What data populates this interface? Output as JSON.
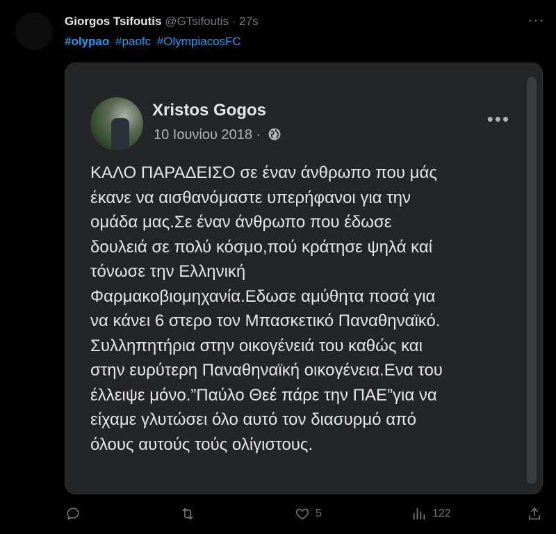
{
  "tweet": {
    "author_name": "Giorgos Tsifoutis",
    "handle": "@GTsifoutis",
    "separator": "·",
    "time": "27s",
    "hashtags": [
      "#olypao",
      "#paofc",
      "#OlympiacosFC"
    ]
  },
  "post": {
    "author": "Xristos Gogos",
    "date": "10 Ιουνίου 2018",
    "date_separator": "·",
    "lines": [
      "ΚΑΛΟ ΠΑΡΑΔΕΙΣΟ σε έναν άνθρωπο που μάς",
      "έκανε να αισθανόμαστε υπερήφανοι για την",
      "ομάδα μας.Σε έναν άνθρωπο που έδωσε",
      "δουλειά σε πολύ κόσμο,πού κράτησε ψηλά καί",
      "τόνωσε την Ελληνική",
      "Φαρμακοβιομηχανία.Εδωσε αμύθητα ποσά για",
      "να κάνει 6 στερο τον Μπασκετικό Παναθηναϊκό.",
      "Συλληπητήρια στην οικογένειά του καθώς και",
      "στην ευρύτερη Παναθηναϊκή οικογένεια.Ενα του",
      "έλλειψε μόνο.”Παύλο Θεέ πάρε την ΠΑΕ”για να",
      "είχαμε γλυτώσει όλο αυτό τον διασυρμό από",
      "όλους αυτούς τούς ολίγιστους."
    ]
  },
  "actions": {
    "reply_count": "",
    "retweet_count": "",
    "like_count": "5",
    "views_count": "122"
  },
  "icons": {
    "reply": "reply-icon",
    "retweet": "retweet-icon",
    "like": "heart-icon",
    "views": "views-icon",
    "share": "share-icon",
    "more": "more-icon",
    "globe": "globe-icon"
  },
  "colors": {
    "background": "#000000",
    "link": "#1d9bf0",
    "muted": "#71767b",
    "fb_card": "#242526"
  }
}
